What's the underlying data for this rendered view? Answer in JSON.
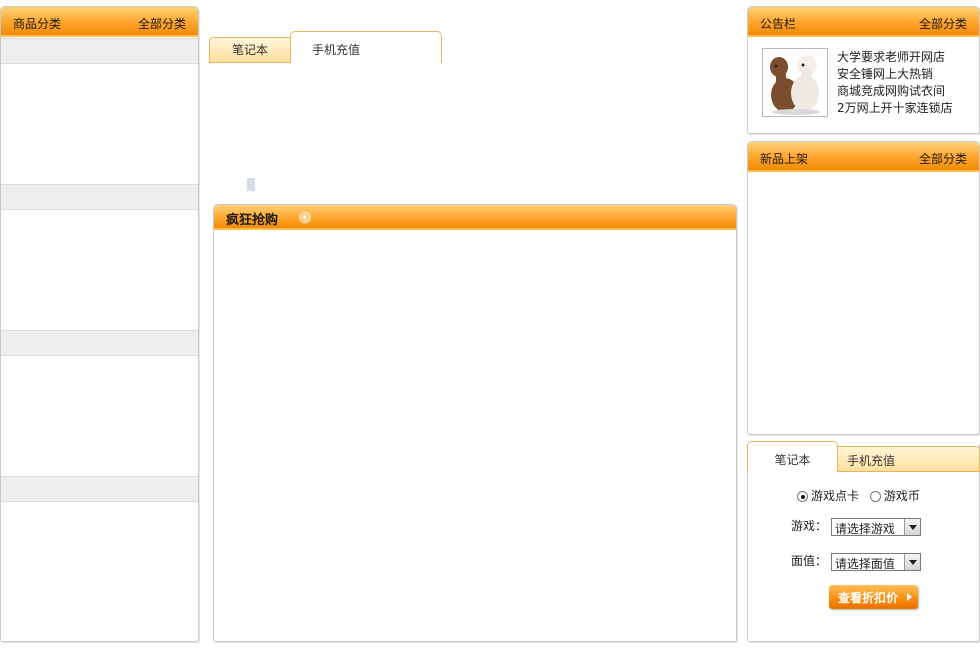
{
  "left_panel": {
    "title": "商品分类",
    "link": "全部分类"
  },
  "center_tabs": [
    {
      "label": "笔记本",
      "active": false
    },
    {
      "label": "手机充值",
      "active": true
    }
  ],
  "flash_sale": {
    "title": "疯狂抢购",
    "arrow_icon": "circle-arrow-right-icon"
  },
  "notice": {
    "title": "公告栏",
    "link": "全部分类",
    "image_icon": "alpaca-plush-image",
    "items": [
      "大学要求老师开网店",
      "安全锤网上大热销",
      "商城竞成网购试衣间",
      "2万网上开十家连锁店"
    ]
  },
  "new_arrivals": {
    "title": "新品上架",
    "link": "全部分类"
  },
  "recharge": {
    "tabs": [
      {
        "label": "笔记本",
        "active": true
      },
      {
        "label": "手机充值",
        "active": false
      }
    ],
    "radio_options": [
      {
        "label": "游戏点卡",
        "checked": true
      },
      {
        "label": "游戏币",
        "checked": false
      }
    ],
    "game_label": "游戏：",
    "game_select": "请选择游戏",
    "value_label": "面值：",
    "value_select": "请选择面值",
    "button_label": "查看折扣价"
  },
  "colors": {
    "accent_orange": "#f18a06",
    "tab_border": "#e8b660"
  }
}
